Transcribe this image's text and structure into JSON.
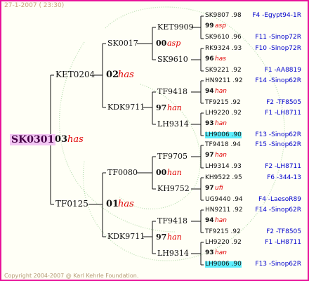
{
  "header": "27-1-2007 ( 23:30)",
  "footer": "Copyright 2004-2007 @ Karl Kehrle Foundation.",
  "root": {
    "id": "SK0301"
  },
  "gen1": [
    {
      "id": "KET0204"
    },
    {
      "year": "03",
      "dam": "has"
    },
    {
      "id": "TF0125"
    },
    {
      "year": "01",
      "dam": "has"
    }
  ],
  "gen1_root": {
    "year": "03",
    "dam": "has"
  },
  "gen2": [
    {
      "id": "SK0017"
    },
    {
      "year": "02",
      "dam": "has"
    },
    {
      "id": "KDK9711"
    },
    {
      "id": "TF0080"
    },
    {
      "year": "01",
      "dam": "has"
    },
    {
      "id": "KDK9711"
    }
  ],
  "gen3": [
    {
      "id": "KET9909",
      "year": "00",
      "dam": "asp",
      "sire": "SK9610"
    },
    {
      "id": "TF9418",
      "year": "97",
      "dam": "han",
      "sire": "LH9314"
    },
    {
      "id": "TF9705",
      "year": "00",
      "dam": "han",
      "sire": "KH9752"
    },
    {
      "id": "TF9418",
      "year": "97",
      "dam": "han",
      "sire": "LH9314"
    }
  ],
  "gen4": [
    {
      "top": "SK9807 .98",
      "mid_year": "99",
      "mid_dam": "asp",
      "bot": "SK9610 .96",
      "pop_top": "F4 -Egypt94-1R",
      "pop_bot": "F11 -Sinop72R"
    },
    {
      "top": "RK9324 .93",
      "mid_year": "96",
      "mid_dam": "has",
      "bot": "SK9221 .92",
      "pop_top": "F10 -Sinop72R",
      "pop_bot": "F1 -AA8819"
    },
    {
      "top": "HN9211 .92",
      "mid_year": "94",
      "mid_dam": "han",
      "bot": "TF9215 .92",
      "pop_top": "F14 -Sinop62R",
      "pop_bot": "F2 -TF8505"
    },
    {
      "top": "LH9220 .92",
      "mid_year": "93",
      "mid_dam": "han",
      "bot": "LH9006 .90",
      "pop_top": "F1 -LH8711",
      "pop_bot": "F13 -Sinop62R"
    },
    {
      "top": "TF9418 .94",
      "mid_year": "97",
      "mid_dam": "han",
      "bot": "LH9314 .93",
      "pop_top": "F15 -Sinop62R",
      "pop_bot": "F2 -LH8711"
    },
    {
      "top": "KH9522 .95",
      "mid_year": "97",
      "mid_dam": "ufi",
      "bot": "UG9440 .94",
      "pop_top": "F6 -344-13",
      "pop_bot": "F4 -LaesoR89"
    },
    {
      "top": "HN9211 .92",
      "mid_year": "94",
      "mid_dam": "han",
      "bot": "TF9215 .92",
      "pop_top": "F14 -Sinop62R",
      "pop_bot": "F2 -TF8505"
    },
    {
      "top": "LH9220 .92",
      "mid_year": "93",
      "mid_dam": "han",
      "bot": "LH9006 .90",
      "pop_top": "F1 -LH8711",
      "pop_bot": "F13 -Sinop62R"
    }
  ]
}
